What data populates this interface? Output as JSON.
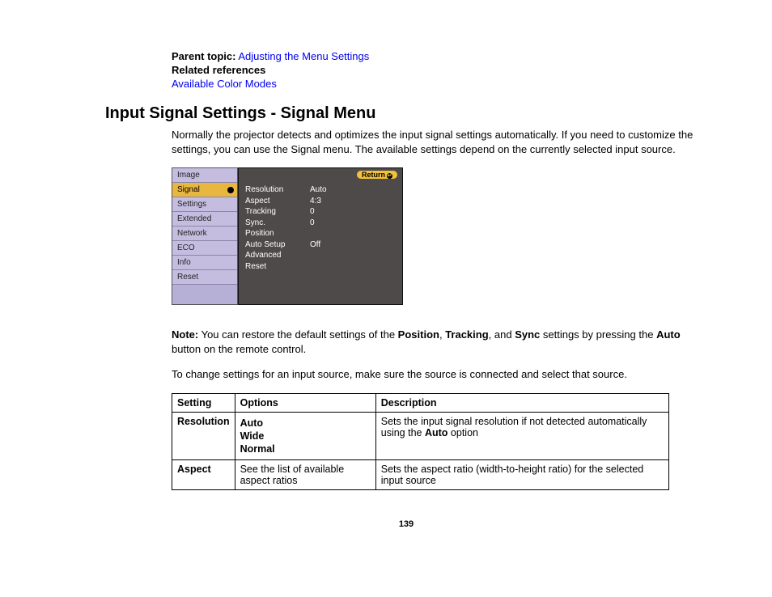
{
  "meta": {
    "parentTopicLabel": "Parent topic:",
    "parentTopicLink": "Adjusting the Menu Settings",
    "relatedRefsLabel": "Related references",
    "relatedRefsLink": "Available Color Modes"
  },
  "heading": "Input Signal Settings - Signal Menu",
  "intro": "Normally the projector detects and optimizes the input signal settings automatically. If you need to customize the settings, you can use the Signal menu. The available settings depend on the currently selected input source.",
  "osd": {
    "tabs": [
      "Image",
      "Signal",
      "Settings",
      "Extended",
      "Network",
      "ECO",
      "Info",
      "Reset"
    ],
    "selectedTab": "Signal",
    "returnLabel": "Return",
    "rows": [
      {
        "k": "Resolution",
        "v": "Auto"
      },
      {
        "k": "Aspect",
        "v": "4:3"
      },
      {
        "k": "Tracking",
        "v": "0"
      },
      {
        "k": "Sync.",
        "v": "0"
      },
      {
        "k": "Position",
        "v": ""
      },
      {
        "k": "Auto Setup",
        "v": "Off"
      },
      {
        "k": "Advanced",
        "v": ""
      },
      {
        "k": "Reset",
        "v": ""
      }
    ]
  },
  "note": {
    "label": "Note:",
    "pre": " You can restore the default settings of the ",
    "b1": "Position",
    "mid1": ", ",
    "b2": "Tracking",
    "mid2": ", and ",
    "b3": "Sync",
    "mid3": " settings by pressing the ",
    "b4": "Auto",
    "post": " button on the remote control."
  },
  "instruction": "To change settings for an input source, make sure the source is connected and select that source.",
  "table": {
    "headers": [
      "Setting",
      "Options",
      "Description"
    ],
    "rows": [
      {
        "setting": "Resolution",
        "options": [
          "Auto",
          "Wide",
          "Normal"
        ],
        "descPre": "Sets the input signal resolution if not detected automatically using the ",
        "descBold": "Auto",
        "descPost": " option"
      },
      {
        "setting": "Aspect",
        "optionsText": "See the list of available aspect ratios",
        "desc": "Sets the aspect ratio (width-to-height ratio) for the selected input source"
      }
    ]
  },
  "pageNumber": "139"
}
